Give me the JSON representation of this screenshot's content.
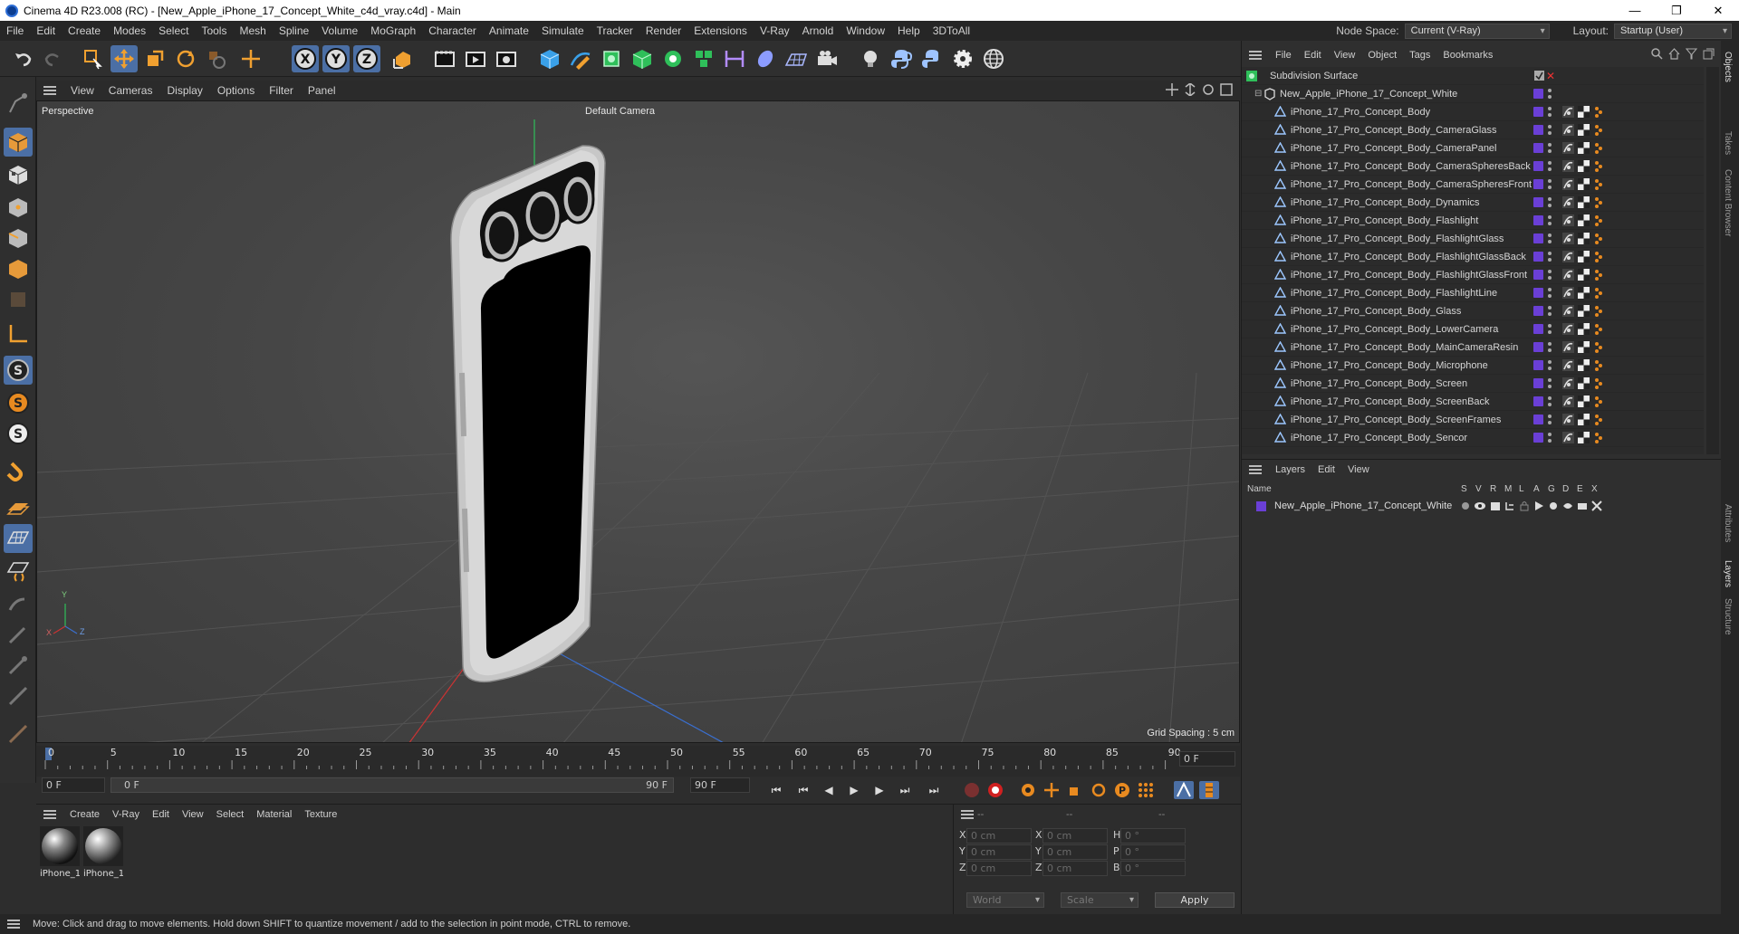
{
  "window": {
    "title": "Cinema 4D R23.008 (RC) - [New_Apple_iPhone_17_Concept_White_c4d_vray.c4d] - Main",
    "controls": [
      "—",
      "❐",
      "✕"
    ]
  },
  "menu": [
    "File",
    "Edit",
    "Create",
    "Modes",
    "Select",
    "Tools",
    "Mesh",
    "Spline",
    "Volume",
    "MoGraph",
    "Character",
    "Animate",
    "Simulate",
    "Tracker",
    "Render",
    "Extensions",
    "V-Ray",
    "Arnold",
    "Window",
    "Help",
    "3DToAll"
  ],
  "nodespace": {
    "label": "Node Space:",
    "value": "Current (V-Ray)",
    "layout_label": "Layout:",
    "layout_value": "Startup (User)"
  },
  "viewport": {
    "menu": [
      "View",
      "Cameras",
      "Display",
      "Options",
      "Filter",
      "Panel"
    ],
    "projection": "Perspective",
    "camera": "Default Camera",
    "grid_spacing": "Grid Spacing : 5 cm",
    "axes": {
      "x": "X",
      "y": "Y",
      "z": "Z"
    }
  },
  "timeline": {
    "ticks": [
      "0",
      "5",
      "10",
      "15",
      "20",
      "25",
      "30",
      "35",
      "40",
      "45",
      "50",
      "55",
      "60",
      "65",
      "70",
      "75",
      "80",
      "85",
      "90"
    ],
    "current_frame": "0 F",
    "start_field": "0 F",
    "range_start": "0 F",
    "range_end": "90 F",
    "end_field": "90 F"
  },
  "materials": {
    "menu": [
      "Create",
      "V-Ray",
      "Edit",
      "View",
      "Select",
      "Material",
      "Texture"
    ],
    "items": [
      {
        "label": "iPhone_1"
      },
      {
        "label": "iPhone_1"
      }
    ]
  },
  "coords": {
    "headers": [
      "--",
      "--",
      "--"
    ],
    "rows": [
      {
        "a": "X",
        "av": "0 cm",
        "b": "X",
        "bv": "0 cm",
        "c": "H",
        "cv": "0 °"
      },
      {
        "a": "Y",
        "av": "0 cm",
        "b": "Y",
        "bv": "0 cm",
        "c": "P",
        "cv": "0 °"
      },
      {
        "a": "Z",
        "av": "0 cm",
        "b": "Z",
        "bv": "0 cm",
        "c": "B",
        "cv": "0 °"
      }
    ],
    "world": "World",
    "scale": "Scale",
    "apply": "Apply"
  },
  "status": "Move: Click and drag to move elements. Hold down SHIFT to quantize movement / add to the selection in point mode, CTRL to remove.",
  "objects": {
    "menu": [
      "File",
      "Edit",
      "View",
      "Object",
      "Tags",
      "Bookmarks"
    ],
    "root": "Subdivision Surface",
    "group": "New_Apple_iPhone_17_Concept_White",
    "children": [
      "iPhone_17_Pro_Concept_Body",
      "iPhone_17_Pro_Concept_Body_CameraGlass",
      "iPhone_17_Pro_Concept_Body_CameraPanel",
      "iPhone_17_Pro_Concept_Body_CameraSpheresBack",
      "iPhone_17_Pro_Concept_Body_CameraSpheresFront",
      "iPhone_17_Pro_Concept_Body_Dynamics",
      "iPhone_17_Pro_Concept_Body_Flashlight",
      "iPhone_17_Pro_Concept_Body_FlashlightGlass",
      "iPhone_17_Pro_Concept_Body_FlashlightGlassBack",
      "iPhone_17_Pro_Concept_Body_FlashlightGlassFront",
      "iPhone_17_Pro_Concept_Body_FlashlightLine",
      "iPhone_17_Pro_Concept_Body_Glass",
      "iPhone_17_Pro_Concept_Body_LowerCamera",
      "iPhone_17_Pro_Concept_Body_MainCameraResin",
      "iPhone_17_Pro_Concept_Body_Microphone",
      "iPhone_17_Pro_Concept_Body_Screen",
      "iPhone_17_Pro_Concept_Body_ScreenBack",
      "iPhone_17_Pro_Concept_Body_ScreenFrames",
      "iPhone_17_Pro_Concept_Body_Sencor"
    ]
  },
  "layers": {
    "menu": [
      "Layers",
      "Edit",
      "View"
    ],
    "col_name": "Name",
    "cols": [
      "S",
      "V",
      "R",
      "M",
      "L",
      "A",
      "G",
      "D",
      "E",
      "X"
    ],
    "rows": [
      "New_Apple_iPhone_17_Concept_White"
    ]
  },
  "side_tabs": [
    "Objects",
    "Takes",
    "Content Browser",
    "Attributes",
    "Layers",
    "Structure"
  ],
  "colors": {
    "accent": "#4b6fa5",
    "layer": "#6a3fd6",
    "bg": "#2d2d2d"
  }
}
